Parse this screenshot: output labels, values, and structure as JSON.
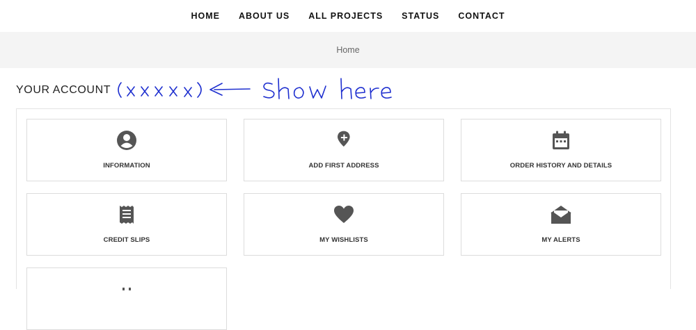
{
  "nav": {
    "items": [
      {
        "label": "HOME"
      },
      {
        "label": "ABOUT US"
      },
      {
        "label": "ALL PROJECTS"
      },
      {
        "label": "STATUS"
      },
      {
        "label": "CONTACT"
      }
    ]
  },
  "breadcrumb": {
    "home_label": "Home"
  },
  "account": {
    "title": "YOUR ACCOUNT",
    "annotation": {
      "placeholder_text": "(xxxxx)",
      "arrow": "<—",
      "note": "show here",
      "ink_color": "#1e2fcf"
    }
  },
  "cards": [
    {
      "label": "INFORMATION",
      "icon": "user-circle-icon"
    },
    {
      "label": "ADD FIRST ADDRESS",
      "icon": "map-pin-plus-icon"
    },
    {
      "label": "ORDER HISTORY AND DETAILS",
      "icon": "calendar-icon"
    },
    {
      "label": "CREDIT SLIPS",
      "icon": "receipt-icon"
    },
    {
      "label": "MY WISHLISTS",
      "icon": "heart-icon"
    },
    {
      "label": "MY ALERTS",
      "icon": "envelope-open-icon"
    }
  ],
  "colors": {
    "icon": "#555555",
    "breadcrumb_bg": "#f4f4f4"
  }
}
